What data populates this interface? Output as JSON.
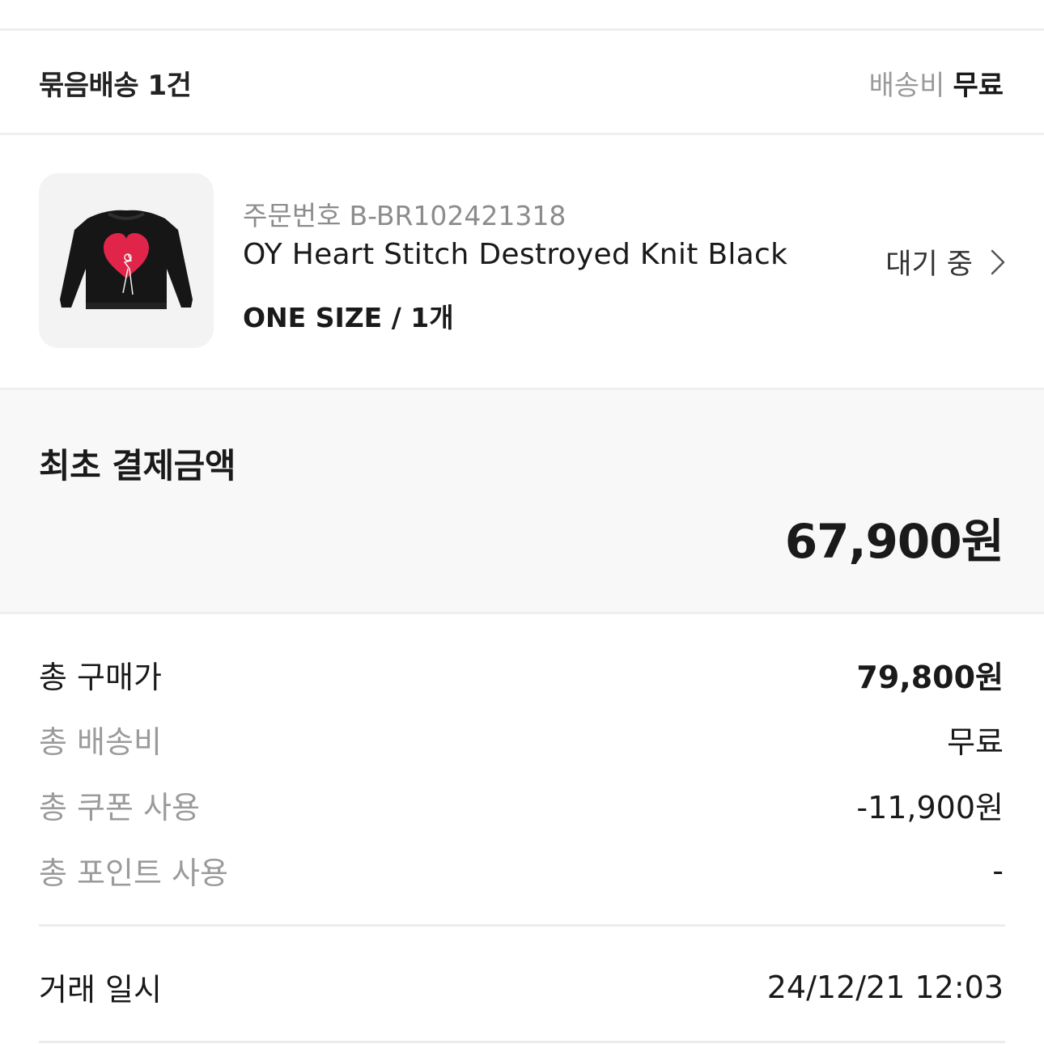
{
  "bundle": {
    "title": "묶음배송 1건",
    "shipping_label": "배송비",
    "shipping_value": "무료"
  },
  "item": {
    "order_label": "주문번호",
    "order_number": "B-BR102421318",
    "name": "OY Heart Stitch Destroyed Knit Black",
    "option": "ONE SIZE / 1개",
    "status": "대기 중",
    "image_icon": "heart-knit-sweater"
  },
  "payment": {
    "title": "최초 결제금액",
    "amount": "67,900원"
  },
  "summary": [
    {
      "label": "총 구매가",
      "value": "79,800원"
    },
    {
      "label": "총 배송비",
      "value": "무료"
    },
    {
      "label": "총 쿠폰 사용",
      "value": "-11,900원"
    },
    {
      "label": "총 포인트 사용",
      "value": "-"
    }
  ],
  "transaction": {
    "label": "거래 일시",
    "value": "24/12/21 12:03"
  },
  "colors": {
    "heart": "#e1254a",
    "sweater": "#161616",
    "muted_text": "#9b9b9b",
    "panel_bg": "#f8f8f8"
  }
}
